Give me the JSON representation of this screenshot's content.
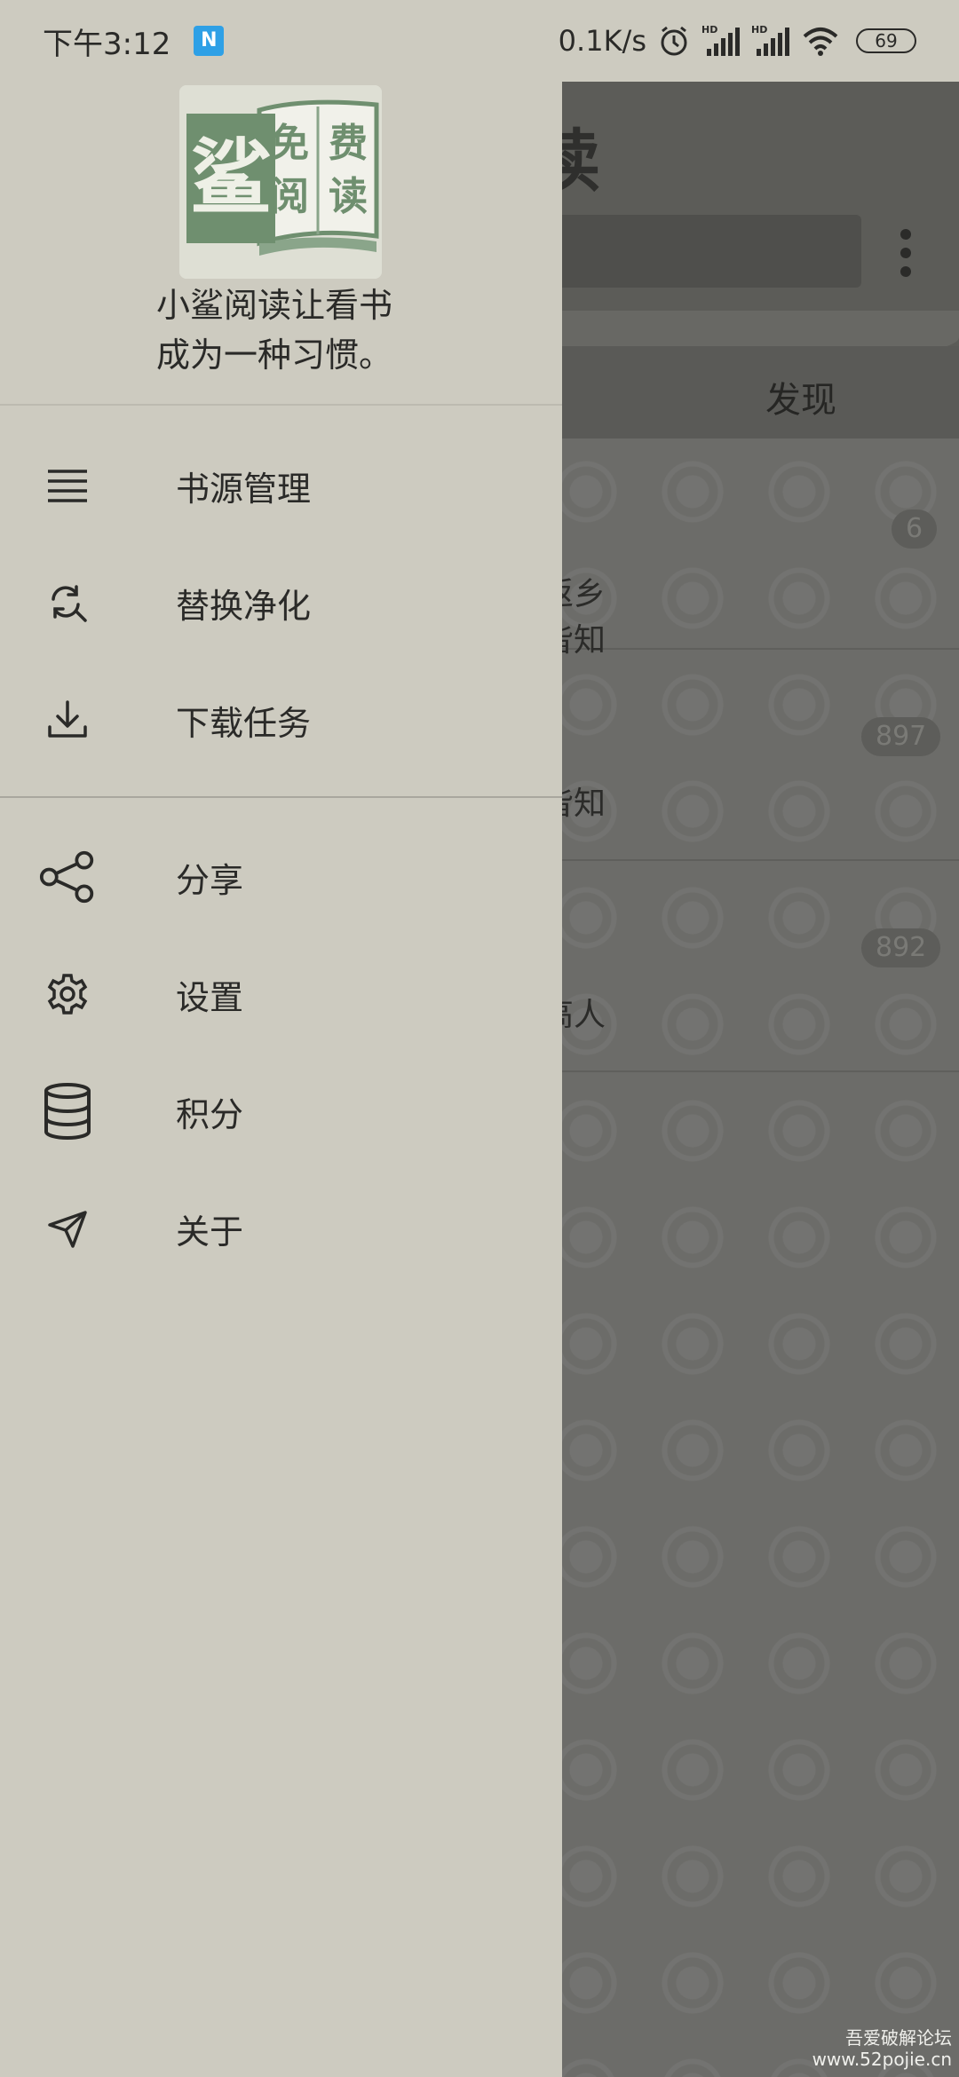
{
  "status_bar": {
    "time": "下午3:12",
    "notification_badge": "N",
    "speed": "0.1K/s",
    "signal1_label": "HD",
    "signal2_label": "HD",
    "battery": "69"
  },
  "drawer": {
    "tagline_line1": "小鲨阅读让看书",
    "tagline_line2": "成为一种习惯。",
    "logo": {
      "main_char": "鲨",
      "book_chars": [
        "免",
        "费",
        "阅",
        "读"
      ]
    },
    "primary_items": [
      {
        "label": "书源管理",
        "icon": "list-icon"
      },
      {
        "label": "替换净化",
        "icon": "replace-icon"
      },
      {
        "label": "下载任务",
        "icon": "download-icon"
      }
    ],
    "secondary_items": [
      {
        "label": "分享",
        "icon": "share-icon"
      },
      {
        "label": "设置",
        "icon": "gear-icon"
      },
      {
        "label": "积分",
        "icon": "database-icon"
      },
      {
        "label": "关于",
        "icon": "send-icon"
      }
    ]
  },
  "background": {
    "title_fragment": "读",
    "tab_discover": "发现",
    "rows": [
      {
        "badge": "6",
        "text_lines": [
          "返乡",
          "皆知"
        ]
      },
      {
        "badge": "897",
        "text_lines": [
          "皆知"
        ]
      },
      {
        "badge": "892",
        "text_lines": [
          "高人"
        ]
      }
    ]
  },
  "watermark": {
    "line1": "吾爱破解论坛",
    "line2": "www.52pojie.cn"
  },
  "colors": {
    "drawer_bg": "#cdcbc0",
    "scrim_bg": "#6c6c69",
    "logo_green": "#6f8f6f"
  }
}
